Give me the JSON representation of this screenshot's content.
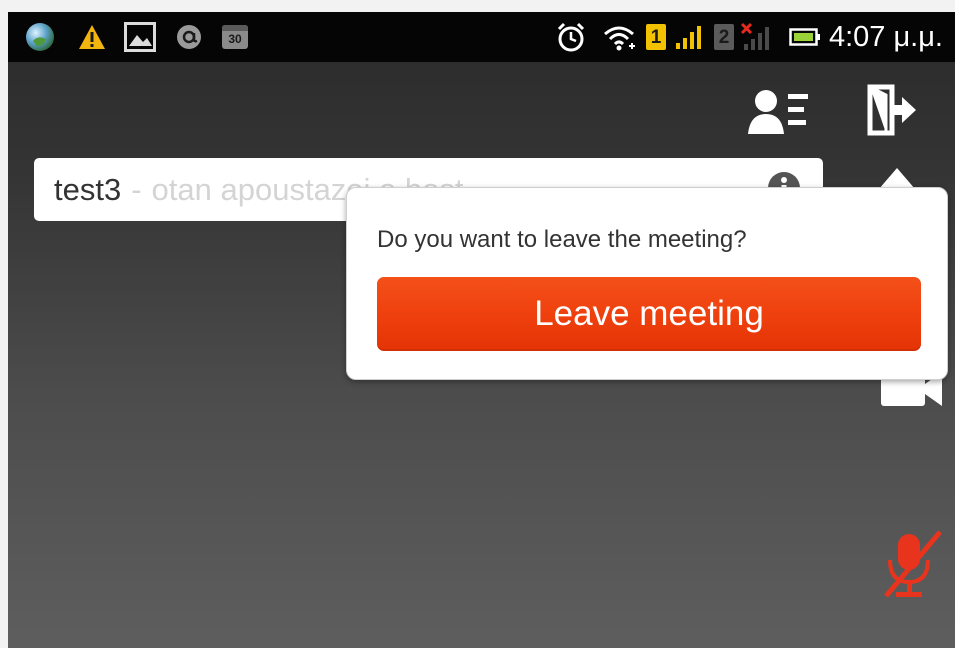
{
  "status_bar": {
    "time": "4:07 μ.μ.",
    "sim1_label": "1",
    "sim2_label": "2",
    "calendar_label": "30"
  },
  "toolbar": {
    "participants_icon": "participants-icon",
    "leave_icon": "leave-icon"
  },
  "meeting": {
    "name": "test3",
    "separator": "-",
    "host": "otan apoustazei o host"
  },
  "leave_popup": {
    "question": "Do you want to leave the meeting?",
    "button_label": "Leave meeting"
  },
  "colors": {
    "accent": "#ef4210",
    "mic_muted": "#e8341c",
    "status_bar": "#050505",
    "sim1": "#f2c200"
  }
}
